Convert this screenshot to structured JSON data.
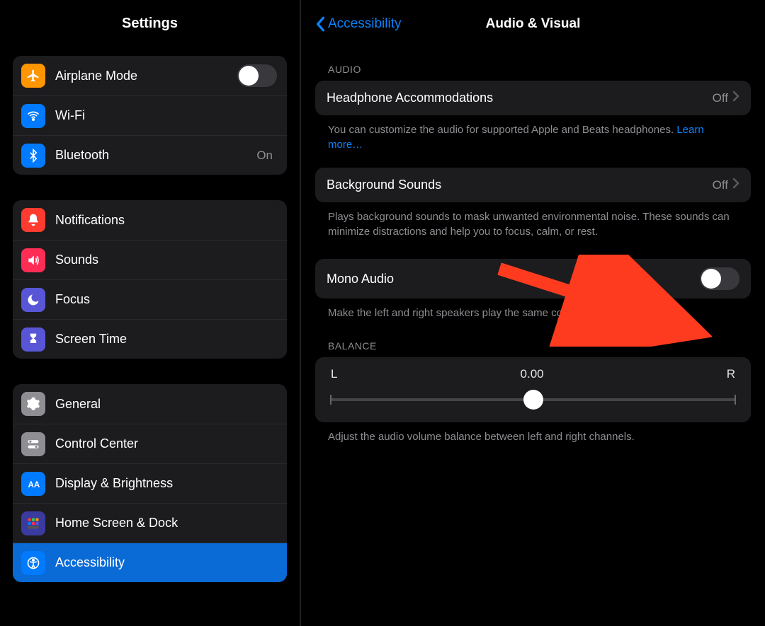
{
  "left": {
    "title": "Settings",
    "groups": [
      [
        {
          "icon": "airplane",
          "color": "#ff9500",
          "label": "Airplane Mode",
          "toggle": false
        },
        {
          "icon": "wifi",
          "color": "#007aff",
          "label": "Wi-Fi"
        },
        {
          "icon": "bluetooth",
          "color": "#007aff",
          "label": "Bluetooth",
          "value": "On"
        }
      ],
      [
        {
          "icon": "bell",
          "color": "#ff3b30",
          "label": "Notifications"
        },
        {
          "icon": "speaker",
          "color": "#ff2d55",
          "label": "Sounds"
        },
        {
          "icon": "moon",
          "color": "#5856d6",
          "label": "Focus"
        },
        {
          "icon": "hourglass",
          "color": "#5856d6",
          "label": "Screen Time"
        }
      ],
      [
        {
          "icon": "gear",
          "color": "#8e8e93",
          "label": "General"
        },
        {
          "icon": "switches",
          "color": "#8e8e93",
          "label": "Control Center"
        },
        {
          "icon": "aa",
          "color": "#007aff",
          "label": "Display & Brightness"
        },
        {
          "icon": "grid",
          "color": "#3355dd",
          "label": "Home Screen & Dock"
        },
        {
          "icon": "accessibility",
          "color": "#007aff",
          "label": "Accessibility",
          "selected": true
        }
      ]
    ]
  },
  "right": {
    "back": "Accessibility",
    "title": "Audio & Visual",
    "sections": {
      "audio_header": "AUDIO",
      "headphone": {
        "label": "Headphone Accommodations",
        "value": "Off"
      },
      "headphone_footer_a": "You can customize the audio for supported Apple and Beats headphones. ",
      "headphone_footer_link": "Learn more…",
      "background": {
        "label": "Background Sounds",
        "value": "Off"
      },
      "background_footer": "Plays background sounds to mask unwanted environmental noise. These sounds can minimize distractions and help you to focus, calm, or rest.",
      "mono": {
        "label": "Mono Audio",
        "on": false
      },
      "mono_footer": "Make the left and right speakers play the same content.",
      "balance_header": "BALANCE",
      "balance": {
        "left": "L",
        "value": "0.00",
        "right": "R"
      },
      "balance_footer": "Adjust the audio volume balance between left and right channels."
    }
  }
}
